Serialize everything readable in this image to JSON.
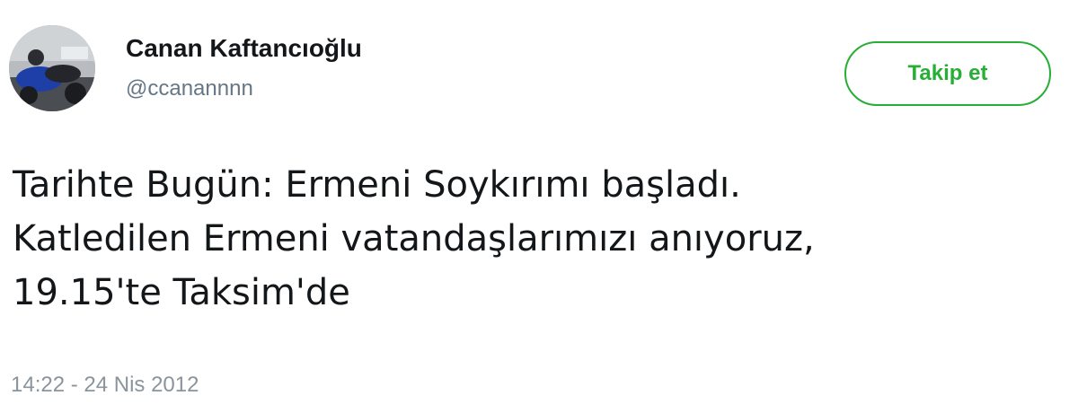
{
  "user": {
    "display_name": "Canan Kaftancıoğlu",
    "handle": "@ccanannnn"
  },
  "follow_button": {
    "label": "Takip et",
    "color": "#27ae34"
  },
  "tweet": {
    "lines": [
      "Tarihte Bugün: Ermeni Soykırımı başladı.",
      "Katledilen Ermeni vatandaşlarımızı anıyoruz,",
      "19.15'te Taksim'de"
    ],
    "timestamp": "14:22 - 24 Nis 2012"
  },
  "colors": {
    "text": "#14171a",
    "secondary": "#657786",
    "accent": "#27ae34"
  }
}
